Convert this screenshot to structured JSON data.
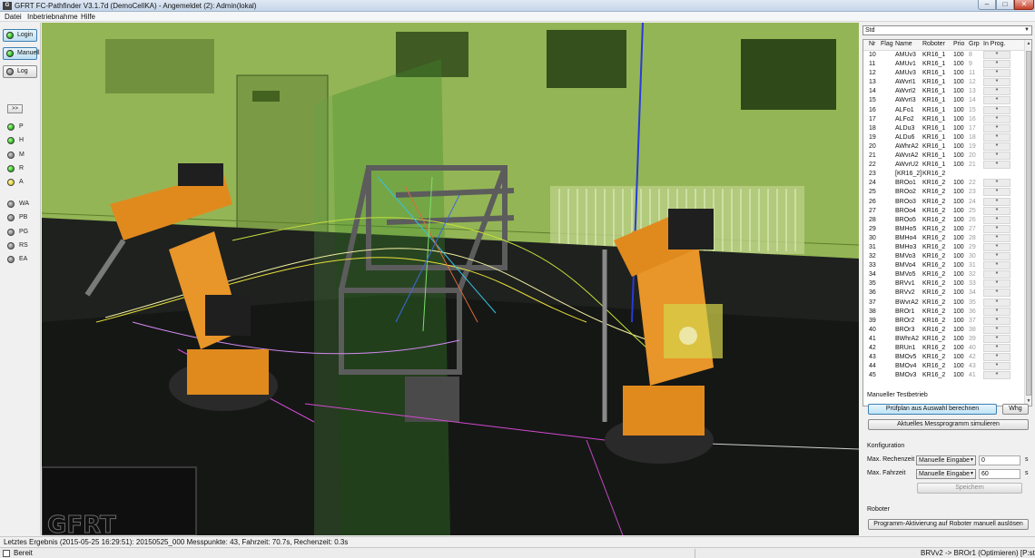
{
  "window": {
    "title": "GFRT FC-Pathfinder V3.1.7d (DemoCellKA) - Angemeldet (2): Admin(lokal)",
    "icon_text": "G",
    "min_glyph": "–",
    "max_glyph": "□",
    "close_glyph": "✕"
  },
  "menu": {
    "items": [
      "Datei",
      "Inbetriebnahme",
      "Hilfe"
    ]
  },
  "sidebar": {
    "buttons": [
      {
        "label": "Login",
        "led": "green"
      },
      {
        "label": "Manuell",
        "led": "green"
      },
      {
        "label": "Log",
        "led": "gray"
      }
    ],
    "collapse_label": ">>",
    "indicators": [
      {
        "label": "P",
        "led": "green"
      },
      {
        "label": "H",
        "led": "green"
      },
      {
        "label": "M",
        "led": "gray"
      },
      {
        "label": "R",
        "led": "green"
      },
      {
        "label": "A",
        "led": "yellow"
      },
      {
        "label": "WA",
        "led": "gray"
      },
      {
        "label": "PB",
        "led": "gray"
      },
      {
        "label": "PG",
        "led": "gray"
      },
      {
        "label": "RS",
        "led": "gray"
      },
      {
        "label": "EA",
        "led": "gray"
      }
    ]
  },
  "viewport": {
    "watermark": "GFRT"
  },
  "panel": {
    "program_select": "Std",
    "table": {
      "columns": [
        "Nr",
        "Flag",
        "Name",
        "Roboter",
        "Prio",
        "Grp",
        "In Prog."
      ],
      "rows": [
        [
          "10",
          "",
          "AMUv3",
          "KR16_1",
          "100",
          "8",
          "*"
        ],
        [
          "11",
          "",
          "AMUv1",
          "KR16_1",
          "100",
          "9",
          "*"
        ],
        [
          "12",
          "",
          "AMUv3",
          "KR16_1",
          "100",
          "11",
          "*"
        ],
        [
          "13",
          "",
          "AWvrI1",
          "KR16_1",
          "100",
          "12",
          "*"
        ],
        [
          "14",
          "",
          "AWvrI2",
          "KR16_1",
          "100",
          "13",
          "*"
        ],
        [
          "15",
          "",
          "AWvrI3",
          "KR16_1",
          "100",
          "14",
          "*"
        ],
        [
          "16",
          "",
          "ALFo1",
          "KR16_1",
          "100",
          "15",
          "*"
        ],
        [
          "17",
          "",
          "ALFo2",
          "KR16_1",
          "100",
          "16",
          "*"
        ],
        [
          "18",
          "",
          "ALDu3",
          "KR16_1",
          "100",
          "17",
          "*"
        ],
        [
          "19",
          "",
          "ALDu6",
          "KR16_1",
          "100",
          "18",
          "*"
        ],
        [
          "20",
          "",
          "AWhrA2",
          "KR16_1",
          "100",
          "19",
          "*"
        ],
        [
          "21",
          "",
          "AWvrA2",
          "KR16_1",
          "100",
          "20",
          "*"
        ],
        [
          "22",
          "",
          "AWvrU2",
          "KR16_1",
          "100",
          "21",
          "*"
        ],
        [
          "23",
          "",
          "[KR16_2]",
          "KR16_2",
          "",
          "",
          ""
        ],
        [
          "24",
          "",
          "BROo1",
          "KR16_2",
          "100",
          "22",
          "*"
        ],
        [
          "25",
          "",
          "BROo2",
          "KR16_2",
          "100",
          "23",
          "*"
        ],
        [
          "26",
          "",
          "BROo3",
          "KR16_2",
          "100",
          "24",
          "*"
        ],
        [
          "27",
          "",
          "BROo4",
          "KR16_2",
          "100",
          "25",
          "*"
        ],
        [
          "28",
          "",
          "BROo5",
          "KR16_2",
          "100",
          "26",
          "*"
        ],
        [
          "29",
          "",
          "BMHo5",
          "KR16_2",
          "100",
          "27",
          "*"
        ],
        [
          "30",
          "",
          "BMHo4",
          "KR16_2",
          "100",
          "28",
          "*"
        ],
        [
          "31",
          "",
          "BMHo3",
          "KR16_2",
          "100",
          "29",
          "*"
        ],
        [
          "32",
          "",
          "BMVo3",
          "KR16_2",
          "100",
          "30",
          "*"
        ],
        [
          "33",
          "",
          "BMVo4",
          "KR16_2",
          "100",
          "31",
          "*"
        ],
        [
          "34",
          "",
          "BMVo5",
          "KR16_2",
          "100",
          "32",
          "*"
        ],
        [
          "35",
          "",
          "BRVv1",
          "KR16_2",
          "100",
          "33",
          "*"
        ],
        [
          "36",
          "",
          "BRVv2",
          "KR16_2",
          "100",
          "34",
          "*"
        ],
        [
          "37",
          "",
          "BWvrA2",
          "KR16_2",
          "100",
          "35",
          "*"
        ],
        [
          "38",
          "",
          "BROr1",
          "KR16_2",
          "100",
          "36",
          "*"
        ],
        [
          "39",
          "",
          "BROr2",
          "KR16_2",
          "100",
          "37",
          "*"
        ],
        [
          "40",
          "",
          "BROr3",
          "KR16_2",
          "100",
          "38",
          "*"
        ],
        [
          "41",
          "",
          "BWhrA2",
          "KR16_2",
          "100",
          "39",
          "*"
        ],
        [
          "42",
          "",
          "BRUn1",
          "KR16_2",
          "100",
          "40",
          "*"
        ],
        [
          "43",
          "",
          "BMOv5",
          "KR16_2",
          "100",
          "42",
          "*"
        ],
        [
          "44",
          "",
          "BMOv4",
          "KR16_2",
          "100",
          "43",
          "*"
        ],
        [
          "45",
          "",
          "BMOv3",
          "KR16_2",
          "100",
          "41",
          "*"
        ]
      ]
    },
    "manual": {
      "heading": "Manueller Testbetrieb",
      "compute_button": "Prüfplan aus Auswahl berechnen",
      "whg_button": "Whg",
      "simulate_button": "Aktuelles Messprogramm simulieren"
    },
    "config": {
      "heading": "Konfiguration",
      "max_compute_label": "Max. Rechenzeit",
      "max_compute_mode": "Manuelle Eingabe",
      "max_compute_value": "0",
      "max_drive_label": "Max. Fahrzeit",
      "max_drive_mode": "Manuelle Eingabe",
      "max_drive_value": "60",
      "unit": "s",
      "save_button": "Speichern"
    },
    "robot": {
      "heading": "Roboter",
      "activate_button": "Programm-Aktivierung auf Roboter manuell auslösen"
    }
  },
  "info": {
    "last_result": "Letztes Ergebnis (2015-05-25 16:29:51): 20150525_000 Messpunkte: 43, Fahrzeit: 70.7s, Rechenzeit: 0.3s"
  },
  "status": {
    "state": "Bereit",
    "right": "BRVv2 -> BROr1 (Optimieren) [P:std/v2]"
  },
  "colors": {
    "scene_wall": "#8fb04f",
    "scene_floor": "#1c1f1c",
    "robot_orange": "#e08a1e",
    "accent": "#3c7fb1"
  }
}
